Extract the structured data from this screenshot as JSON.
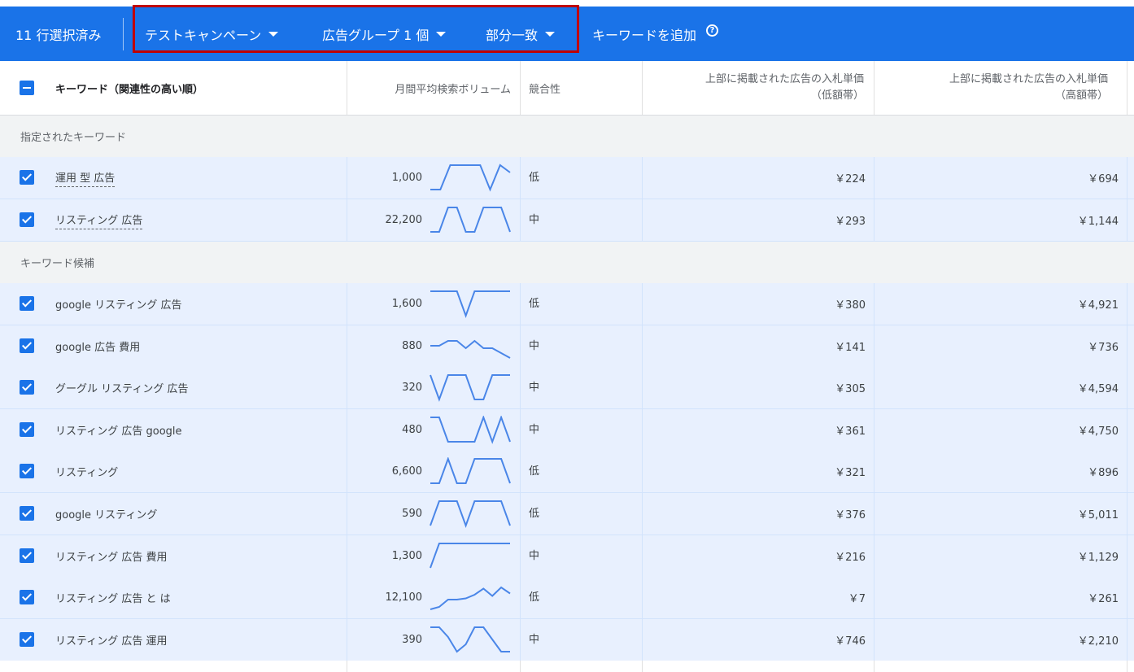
{
  "toolbar": {
    "selected_count": "11 行選択済み",
    "campaign": "テストキャンペーン",
    "ad_group": "広告グループ 1 個",
    "match_type": "部分一致",
    "add_keywords": "キーワードを追加",
    "help_glyph": "?"
  },
  "columns": {
    "keyword": "キーワード（関連性の高い順）",
    "volume": "月間平均検索ボリューム",
    "competition": "競合性",
    "bid_low_line1": "上部に掲載された広告の入札単価",
    "bid_low_line2": "（低額帯）",
    "bid_high_line1": "上部に掲載された広告の入札単価",
    "bid_high_line2": "（高額帯）"
  },
  "sections": {
    "specified": "指定されたキーワード",
    "candidates": "キーワード候補"
  },
  "rows": [
    {
      "keyword": "運用 型 広告",
      "volume": "1,000",
      "competition": "低",
      "bid_low": "￥224",
      "bid_high": "￥694",
      "trend": [
        0,
        0,
        1,
        1,
        1,
        1,
        0,
        1,
        0.7
      ]
    },
    {
      "keyword": "リスティング 広告",
      "volume": "22,200",
      "competition": "中",
      "bid_low": "￥293",
      "bid_high": "￥1,144",
      "trend": [
        0,
        0,
        1,
        1,
        0,
        0,
        1,
        1,
        1,
        0
      ]
    },
    {
      "keyword": "google リスティング 広告",
      "volume": "1,600",
      "competition": "低",
      "bid_low": "￥380",
      "bid_high": "￥4,921",
      "trend": [
        1,
        1,
        1,
        1,
        0,
        1,
        1,
        1,
        1,
        1
      ]
    },
    {
      "keyword": "google 広告 費用",
      "volume": "880",
      "competition": "中",
      "bid_low": "￥141",
      "bid_high": "￥736",
      "trend": [
        0.5,
        0.5,
        0.7,
        0.7,
        0.4,
        0.7,
        0.4,
        0.4,
        0.2,
        0
      ]
    },
    {
      "keyword": "グーグル リスティング 広告",
      "volume": "320",
      "competition": "中",
      "bid_low": "￥305",
      "bid_high": "￥4,594",
      "trend": [
        1,
        0,
        1,
        1,
        1,
        0,
        0,
        1,
        1,
        1
      ]
    },
    {
      "keyword": "リスティング 広告 google",
      "volume": "480",
      "competition": "中",
      "bid_low": "￥361",
      "bid_high": "￥4,750",
      "trend": [
        1,
        1,
        0,
        0,
        0,
        0,
        1,
        0,
        1,
        0
      ]
    },
    {
      "keyword": "リスティング",
      "volume": "6,600",
      "competition": "低",
      "bid_low": "￥321",
      "bid_high": "￥896",
      "trend": [
        0,
        0,
        1,
        0,
        0,
        1,
        1,
        1,
        1,
        0
      ]
    },
    {
      "keyword": "google リスティング",
      "volume": "590",
      "competition": "低",
      "bid_low": "￥376",
      "bid_high": "￥5,011",
      "trend": [
        0,
        1,
        1,
        1,
        0,
        1,
        1,
        1,
        1,
        0
      ]
    },
    {
      "keyword": "リスティング 広告 費用",
      "volume": "1,300",
      "competition": "中",
      "bid_low": "￥216",
      "bid_high": "￥1,129",
      "trend": [
        0,
        1,
        1,
        1,
        1,
        1,
        1,
        1,
        1,
        1
      ]
    },
    {
      "keyword": "リスティング 広告 と は",
      "volume": "12,100",
      "competition": "低",
      "bid_low": "￥7",
      "bid_high": "￥261",
      "trend": [
        0,
        0.1,
        0.4,
        0.4,
        0.45,
        0.6,
        0.85,
        0.55,
        0.9,
        0.65
      ]
    },
    {
      "keyword": "リスティング 広告 運用",
      "volume": "390",
      "competition": "中",
      "bid_low": "￥746",
      "bid_high": "￥2,210",
      "trend": [
        1,
        1,
        0.6,
        0,
        0.3,
        1,
        1,
        0.5,
        0,
        0
      ]
    }
  ],
  "colors": {
    "toolbar_bg": "#1a73e8",
    "row_bg": "#e8f0fe",
    "sparkline": "#4a86e8",
    "highlight_border": "#c00000"
  }
}
